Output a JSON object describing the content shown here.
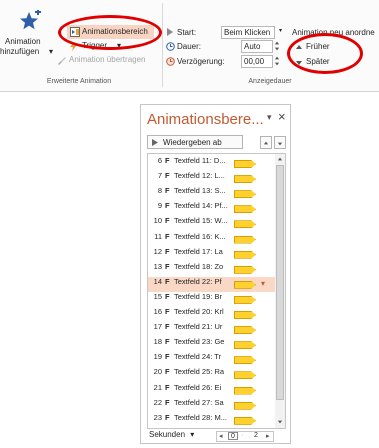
{
  "ribbon": {
    "add_animation": {
      "line1": "Animation",
      "line2": "hinzufügen",
      "caret": "▾"
    },
    "animation_pane": "Animationsbereich",
    "trigger": "Trigger",
    "trigger_caret": "▾",
    "animation_painter": "Animation übertragen",
    "group1_label": "Erweiterte Animation",
    "start_label": "Start:",
    "start_value": "Beim Klicken",
    "duration_label": "Dauer:",
    "duration_value": "Auto",
    "delay_label": "Verzögerung:",
    "delay_value": "00,00",
    "reorder_title": "Animation neu anordne",
    "earlier": "Früher",
    "later": "Später",
    "group2_label": "Anzeigedauer"
  },
  "pane": {
    "title": "Animationsbere...",
    "dropdown_glyph": "▾",
    "close_glyph": "×",
    "play_button": "Wiedergeben ab",
    "rows": [
      {
        "num": "6",
        "flag": "F",
        "label": "Textfeld 11: D..."
      },
      {
        "num": "7",
        "flag": "F",
        "label": "Textfeld 12: L..."
      },
      {
        "num": "8",
        "flag": "F",
        "label": "Textfeld 13: S..."
      },
      {
        "num": "9",
        "flag": "F",
        "label": "Textfeld 14: Pf..."
      },
      {
        "num": "10",
        "flag": "F",
        "label": "Textfeld 15: W..."
      },
      {
        "num": "11",
        "flag": "F",
        "label": "Textfeld 16: K..."
      },
      {
        "num": "12",
        "flag": "F",
        "label": "Textfeld 17: La"
      },
      {
        "num": "13",
        "flag": "F",
        "label": "Textfeld 18: Zo"
      },
      {
        "num": "14",
        "flag": "F",
        "label": "Textfeld 22: Pf"
      },
      {
        "num": "15",
        "flag": "F",
        "label": "Textfeld 19: Br"
      },
      {
        "num": "16",
        "flag": "F",
        "label": "Textfeld 20: Krl"
      },
      {
        "num": "17",
        "flag": "F",
        "label": "Textfeld 21: Ur"
      },
      {
        "num": "18",
        "flag": "F",
        "label": "Textfeld 23: Ge"
      },
      {
        "num": "19",
        "flag": "F",
        "label": "Textfeld 24: Tr"
      },
      {
        "num": "20",
        "flag": "F",
        "label": "Textfeld 25: Ra"
      },
      {
        "num": "21",
        "flag": "F",
        "label": "Textfeld 26: Ei"
      },
      {
        "num": "22",
        "flag": "F",
        "label": "Textfeld 27: Sa"
      },
      {
        "num": "23",
        "flag": "F",
        "label": "Textfeld 28: M..."
      }
    ],
    "selected_row_number": "14",
    "timeline_unit": "Sekunden",
    "timeline_caret": "▾",
    "timeline_start": "0",
    "timeline_end": "2"
  },
  "colors": {
    "title": "#c35a33",
    "annotation": "#e00000",
    "bar": "#ffd12e",
    "selected": "#fad8c6"
  }
}
